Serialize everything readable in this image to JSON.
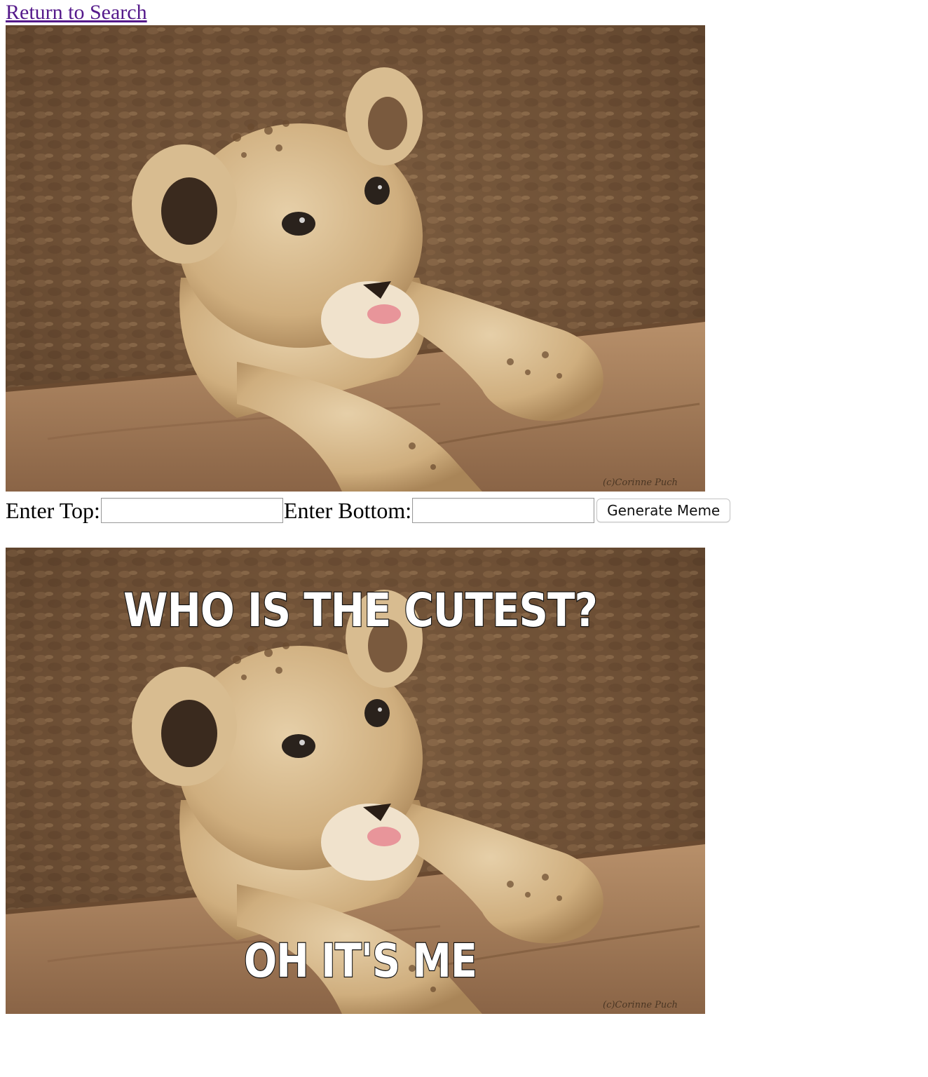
{
  "nav": {
    "return_label": "Return to Search"
  },
  "form": {
    "top_label": "Enter Top:",
    "top_value": "",
    "bottom_label": "Enter Bottom:",
    "bottom_value": "",
    "generate_label": "Generate Meme"
  },
  "original_image": {
    "subject": "lion cub resting paws on a log",
    "watermark": "(c)Corinne Puch"
  },
  "meme_image": {
    "top_text": "WHO IS THE CUTEST?",
    "bottom_text": "OH IT'S ME",
    "watermark": "(c)Corinne Puch"
  }
}
